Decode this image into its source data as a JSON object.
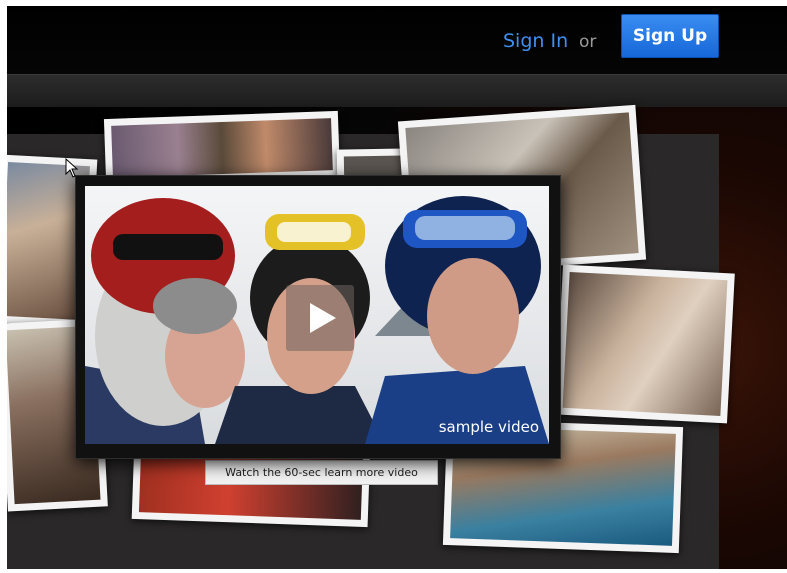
{
  "header": {
    "sign_in_label": "Sign In",
    "or_text": "or",
    "sign_up_label": "Sign Up",
    "accent_color": "#3f8ff0"
  },
  "video": {
    "caption": "sample video",
    "learn_more_label": "Watch the 60-sec learn more video"
  },
  "icons": {
    "play": "play-icon",
    "cursor": "cursor-arrow-icon"
  }
}
